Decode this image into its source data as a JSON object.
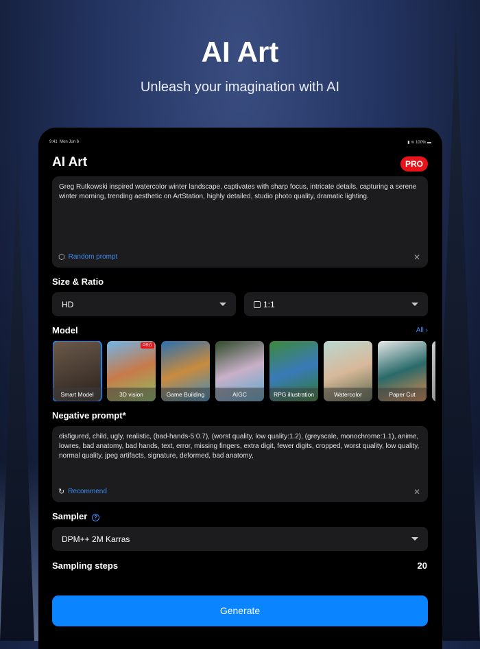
{
  "hero": {
    "title": "AI Art",
    "subtitle": "Unleash your imagination with AI"
  },
  "status_bar": {
    "time": "9:41",
    "date": "Mon Jun 6",
    "battery": "100%"
  },
  "app": {
    "title": "AI Art",
    "pro_badge": "PRO"
  },
  "prompt": {
    "text": "Greg Rutkowski inspired watercolor winter landscape, captivates with sharp focus, intricate details, capturing a serene winter morning, trending aesthetic on ArtStation, highly detailed, studio photo quality, dramatic lighting.",
    "random_label": "Random prompt"
  },
  "size_ratio": {
    "label": "Size & Ratio",
    "size": "HD",
    "ratio": "1:1"
  },
  "model": {
    "label": "Model",
    "all_label": "All",
    "items": [
      {
        "label": "Smart Model",
        "selected": true
      },
      {
        "label": "3D vision",
        "pro": "PRO"
      },
      {
        "label": "Game Building"
      },
      {
        "label": "AIGC"
      },
      {
        "label": "RPG illustration"
      },
      {
        "label": "Watercolor"
      },
      {
        "label": "Paper Cut"
      }
    ]
  },
  "negative": {
    "label": "Negative prompt*",
    "text": "disfigured, child, ugly, realistic, (bad-hands-5:0.7), (worst quality, low quality:1.2), (greyscale, monochrome:1.1), anime, lowres, bad anatomy, bad hands, text, error, missing fingers, extra digit, fewer digits, cropped, worst quality, low quality, normal quality, jpeg artifacts, signature, deformed, bad anatomy,",
    "recommend_label": "Recommend"
  },
  "sampler": {
    "label": "Sampler",
    "value": "DPM++ 2M Karras"
  },
  "steps": {
    "label": "Sampling steps",
    "value": "20"
  },
  "generate_label": "Generate",
  "colors": {
    "accent": "#0a84ff",
    "pro": "#e5141a"
  }
}
